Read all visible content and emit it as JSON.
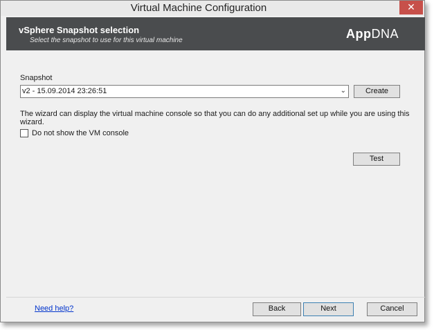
{
  "window": {
    "title": "Virtual Machine Configuration",
    "close_glyph": "✕"
  },
  "header": {
    "title": "vSphere Snapshot selection",
    "subtitle": "Select the snapshot to use for this virtual machine",
    "logo_bold": "App",
    "logo_rest": "DNA"
  },
  "snapshot": {
    "label": "Snapshot",
    "selected": "v2 - 15.09.2014 23:26:51",
    "create_label": "Create"
  },
  "info_text": "The wizard can display the virtual machine console so that you can do any additional set up while you are using this wizard.",
  "console_checkbox": {
    "label": "Do not show the VM console",
    "checked": false
  },
  "test_label": "Test",
  "footer": {
    "help": "Need help?",
    "back": "Back",
    "next": "Next",
    "cancel": "Cancel"
  },
  "colors": {
    "header_bg": "#4a4c4e",
    "close_bg": "#c7504a",
    "link": "#0033cc"
  }
}
